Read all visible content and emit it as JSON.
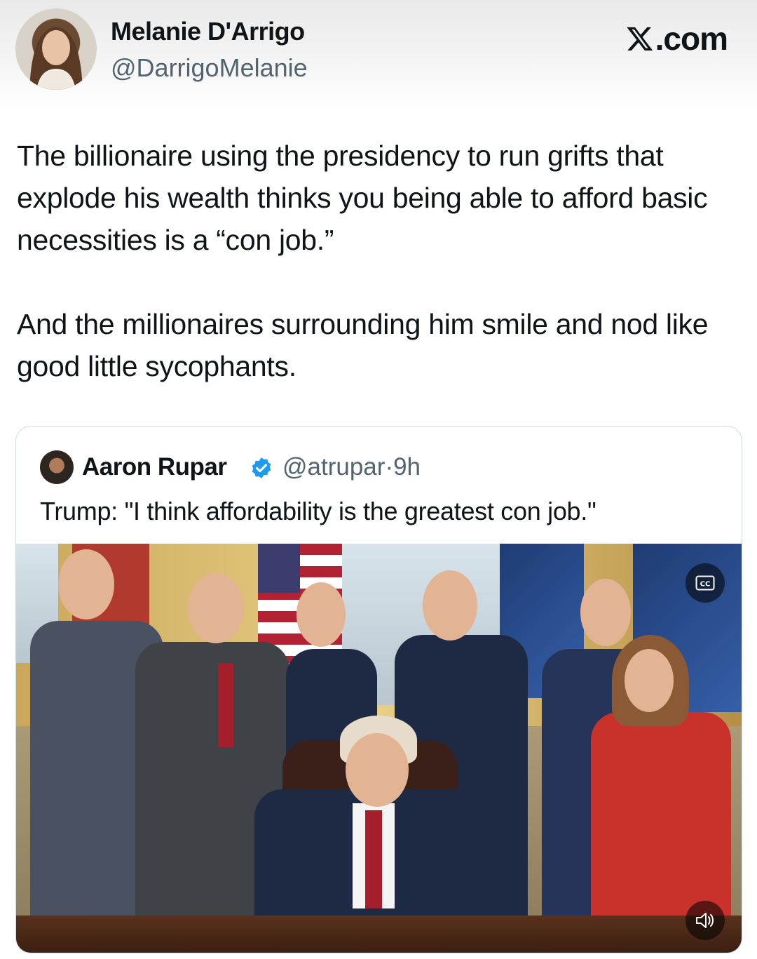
{
  "author": {
    "display_name": "Melanie D'Arrigo",
    "handle": "@DarrigoMelanie"
  },
  "brand": {
    "label": ".com",
    "icon": "x-logo-icon"
  },
  "tweet": {
    "paragraphs": [
      "The billionaire using the presidency to run grifts that explode his wealth thinks you being able to afford basic necessities is a “con job.”",
      "And the millionaires surrounding him smile and nod like good little sycophants."
    ]
  },
  "quote": {
    "display_name": "Aaron Rupar",
    "verified_icon": "verified-badge-icon",
    "handle": "@atrupar",
    "separator": "·",
    "time": "9h",
    "text": "Trump: \"I think affordability is the greatest con job.\"",
    "media": {
      "kind": "video",
      "cc_icon": "closed-captions-icon",
      "volume_icon": "speaker-icon",
      "colors": {
        "suit_navy": "#1e2a44",
        "suit_gray": "#4a4d52",
        "tie_red": "#a51f2b",
        "jacket_red": "#c8322b",
        "desk_wood": "#4a2816"
      }
    }
  },
  "colors": {
    "text_primary": "#0f1419",
    "text_secondary": "#536471",
    "verified_blue": "#1d9bf0",
    "border": "#cfd9de"
  }
}
